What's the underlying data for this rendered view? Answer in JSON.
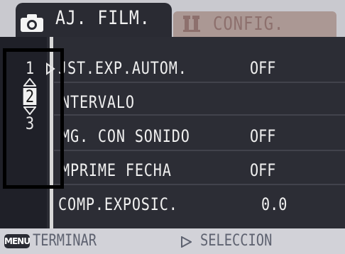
{
  "tabs": {
    "shooting": {
      "icon": "camera-icon",
      "label": "AJ. FILM."
    },
    "setup": {
      "icon": "setup-icon",
      "label": "CONFIG."
    }
  },
  "pages": {
    "numbers": [
      "1",
      "2",
      "3"
    ],
    "current": "2"
  },
  "menu": {
    "items": [
      {
        "label": "JST.EXP.AUTOM.",
        "value": "OFF"
      },
      {
        "label": "NTERVALO",
        "value": ""
      },
      {
        "label": "MG. CON SONIDO",
        "value": "OFF"
      },
      {
        "label": "MPRIME FECHA",
        "value": "OFF"
      },
      {
        "label": "COMP.EXPOSIC.",
        "value": "0.0"
      }
    ]
  },
  "footer": {
    "menu_button_label": "MENU",
    "exit_label": "TERMINAR",
    "select_label": "SELECCION"
  },
  "colors": {
    "tab_bar": "#c9c9cf",
    "active_tab": "#2a2b33",
    "inactive_tab": "#ab9894",
    "menu_background": "#2c2d35",
    "text": "#f0f0f0",
    "footer": "#d2d2d8"
  }
}
